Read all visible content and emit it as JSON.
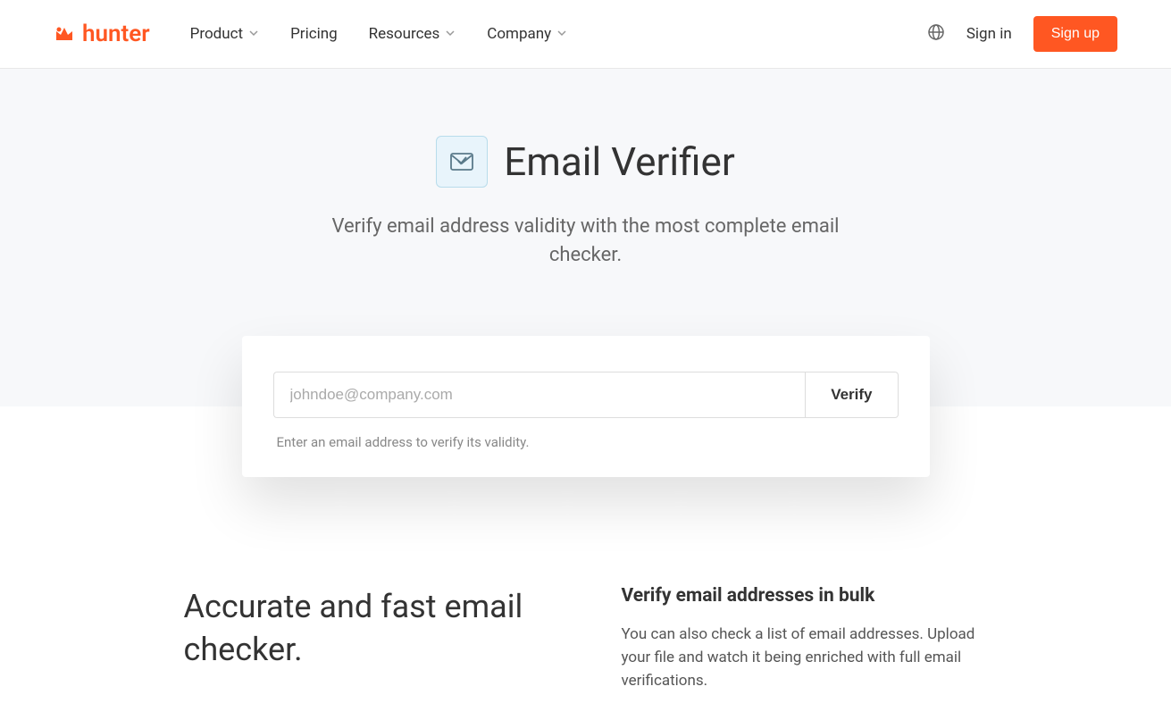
{
  "header": {
    "logo_text": "hunter",
    "nav": {
      "product": "Product",
      "pricing": "Pricing",
      "resources": "Resources",
      "company": "Company"
    },
    "sign_in": "Sign in",
    "sign_up": "Sign up"
  },
  "hero": {
    "title": "Email Verifier",
    "subtitle": "Verify email address validity with the most complete email checker."
  },
  "verify": {
    "placeholder": "johndoe@company.com",
    "button": "Verify",
    "hint": "Enter an email address to verify its validity."
  },
  "content": {
    "title": "Accurate and fast email checker.",
    "heading": "Verify email addresses in bulk",
    "text": "You can also check a list of email addresses. Upload your file and watch it being enriched with full email verifications."
  }
}
